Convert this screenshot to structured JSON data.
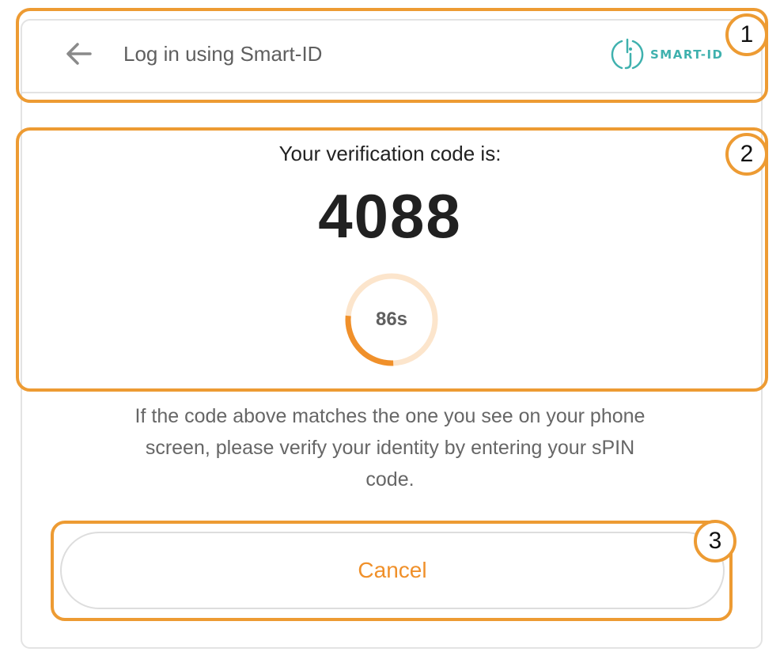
{
  "header": {
    "title": "Log in using Smart-ID",
    "back_icon": "arrow-left-icon",
    "logo_text": "SMART-ID"
  },
  "verification": {
    "label": "Your verification code is:",
    "code": "4088",
    "timer_text": "86s",
    "timer_progress": 0.27
  },
  "info": {
    "message": "If the code above matches the one you see on your phone screen, please verify your identity by entering your sPIN code."
  },
  "actions": {
    "cancel_label": "Cancel"
  },
  "annotations": {
    "labels": [
      "1",
      "2",
      "3"
    ]
  },
  "colors": {
    "accent": "#ED9B33",
    "cancel_text": "#F0902A",
    "brand": "#3FB1AE",
    "timer_track": "#FCE5CC",
    "timer_fill": "#F0902A"
  }
}
